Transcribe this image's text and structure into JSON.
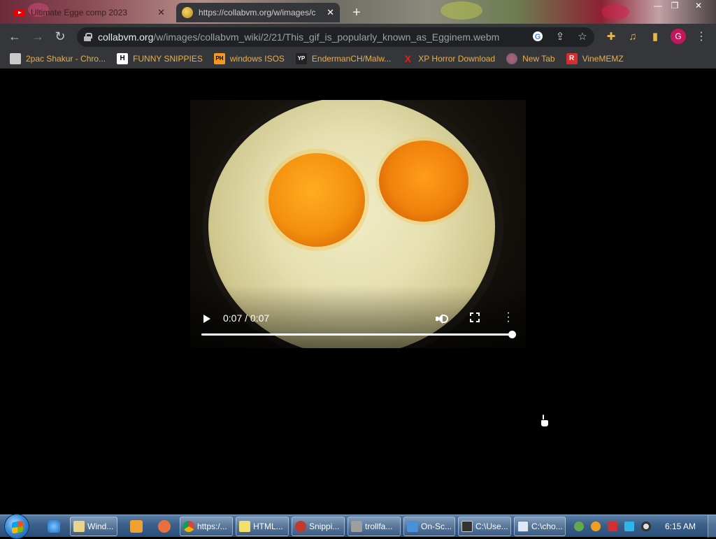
{
  "browser": {
    "tabs": [
      {
        "title": "Ultimate Egge comp 2023",
        "icon": "youtube-icon",
        "active": false
      },
      {
        "title": "https://collabvm.org/w/images/c",
        "icon": "collabvm-icon",
        "active": true
      }
    ],
    "close_glyph": "✕",
    "new_tab_glyph": "+",
    "window_controls": {
      "minimize": "—",
      "restore": "❐",
      "close": "✕"
    },
    "nav": {
      "back": "←",
      "forward": "→",
      "reload": "↻"
    },
    "url": {
      "host": "collabvm.org",
      "path": "/w/images/collabvm_wiki/2/21/This_gif_is_popularly_known_as_Egginem.webm"
    },
    "toolbar_icons": [
      "google-icon",
      "share-icon",
      "bookmark-star-icon",
      "extensions-icon",
      "media-control-icon",
      "side-panel-icon"
    ],
    "profile_initial": "G",
    "menu_glyph": "⋮"
  },
  "bookmarks": [
    {
      "label": "2pac Shakur - Chro...",
      "icon": "2pac-favicon",
      "color": "#d8d8d8"
    },
    {
      "label": "FUNNY SNIPPIES",
      "icon": "h-favicon",
      "glyph": "H",
      "color": "#ffffff"
    },
    {
      "label": "windows ISOS",
      "icon": "pornhub-favicon",
      "glyph": "PH",
      "color": "#f7971e"
    },
    {
      "label": "EndermanCH/Malw...",
      "icon": "yp-favicon",
      "glyph": "YP",
      "color": "#222222"
    },
    {
      "label": "XP Horror Download",
      "icon": "x-favicon",
      "glyph": "X",
      "color": "#e02020"
    },
    {
      "label": "New Tab",
      "icon": "newtab-favicon",
      "color": "#888888"
    },
    {
      "label": "VineMEMZ",
      "icon": "r-favicon",
      "glyph": "R",
      "color": "#d32f2f"
    }
  ],
  "video": {
    "time_display": "0:07 / 0:07",
    "progress": 1.0,
    "controls": [
      "play-button",
      "volume-button",
      "fullscreen-button",
      "more-options-button"
    ]
  },
  "taskbar": {
    "pinned": [
      {
        "name": "internet-explorer",
        "color": "#3a8fd8"
      },
      {
        "name": "windows-explorer",
        "color": "#e2c25a"
      },
      {
        "name": "media-player",
        "color": "#f0a030"
      },
      {
        "name": "paint-app",
        "color": "#e87040"
      }
    ],
    "tasks": [
      {
        "label": "Wind...",
        "color": "#e8d48a"
      },
      {
        "label": "https:/...",
        "color": "#4caf50"
      },
      {
        "label": "HTML...",
        "color": "#f2e06c"
      },
      {
        "label": "Snippi...",
        "color": "#c0392b"
      },
      {
        "label": "trollfa...",
        "color": "#9e9e9e"
      },
      {
        "label": "On-Sc...",
        "color": "#4a90d9"
      },
      {
        "label": "C:\\Use...",
        "color": "#333333"
      },
      {
        "label": "C:\\cho...",
        "color": "#dfe8f5"
      }
    ],
    "tray": [
      {
        "name": "network-icon",
        "color": "#62a84d"
      },
      {
        "name": "search-tray-icon",
        "color": "#f0a020"
      },
      {
        "name": "flag-icon",
        "color": "#d03030"
      },
      {
        "name": "monitor-icon",
        "color": "#2fb6e8"
      },
      {
        "name": "obs-icon",
        "color": "#e0e0e0"
      }
    ],
    "clock": "6:15 AM"
  }
}
